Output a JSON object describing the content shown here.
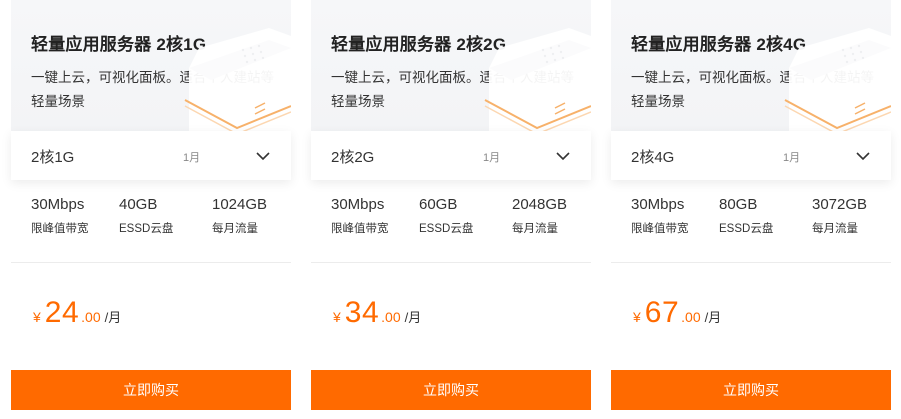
{
  "colors": {
    "accent": "#ff6a00",
    "header_bg": "#f4f5f7",
    "text": "#333333"
  },
  "cards": [
    {
      "title": "轻量应用服务器 2核1G",
      "description": "一键上云，可视化面板。适合个人建站等轻量场景",
      "selected_config": "2核1G",
      "period": "1月",
      "specs": [
        {
          "value": "30Mbps",
          "label": "限峰值带宽"
        },
        {
          "value": "40GB",
          "label": "ESSD云盘"
        },
        {
          "value": "1024GB",
          "label": "每月流量"
        }
      ],
      "price": {
        "currency": "¥",
        "integer": "24",
        "decimal": ".00",
        "unit": "/月"
      },
      "buy_label": "立即购买"
    },
    {
      "title": "轻量应用服务器 2核2G",
      "description": "一键上云，可视化面板。适合个人建站等轻量场景",
      "selected_config": "2核2G",
      "period": "1月",
      "specs": [
        {
          "value": "30Mbps",
          "label": "限峰值带宽"
        },
        {
          "value": "60GB",
          "label": "ESSD云盘"
        },
        {
          "value": "2048GB",
          "label": "每月流量"
        }
      ],
      "price": {
        "currency": "¥",
        "integer": "34",
        "decimal": ".00",
        "unit": "/月"
      },
      "buy_label": "立即购买"
    },
    {
      "title": "轻量应用服务器 2核4G",
      "description": "一键上云，可视化面板。适合个人建站等轻量场景",
      "selected_config": "2核4G",
      "period": "1月",
      "specs": [
        {
          "value": "30Mbps",
          "label": "限峰值带宽"
        },
        {
          "value": "80GB",
          "label": "ESSD云盘"
        },
        {
          "value": "3072GB",
          "label": "每月流量"
        }
      ],
      "price": {
        "currency": "¥",
        "integer": "67",
        "decimal": ".00",
        "unit": "/月"
      },
      "buy_label": "立即购买"
    }
  ]
}
